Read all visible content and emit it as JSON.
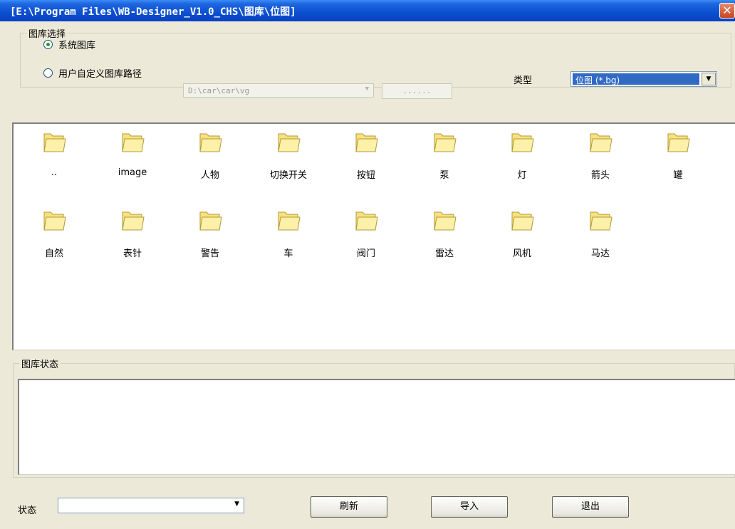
{
  "window": {
    "title": "[E:\\Program Files\\WB-Designer_V1.0_CHS\\图库\\位图]",
    "close_glyph": "✕"
  },
  "library_select": {
    "legend": "图库选择",
    "system_label": "系统图库",
    "custom_label": "用户自定义图库路径",
    "custom_path": "D:\\car\\car\\vg",
    "browse_label": "......",
    "type_label": "类型",
    "type_value": "位图 (*.bg)",
    "selected": "system"
  },
  "files": [
    {
      "label": ".."
    },
    {
      "label": "image"
    },
    {
      "label": "人物"
    },
    {
      "label": "切换开关"
    },
    {
      "label": "按钮"
    },
    {
      "label": "泵"
    },
    {
      "label": "灯"
    },
    {
      "label": "箭头"
    },
    {
      "label": "罐"
    },
    {
      "label": "自然"
    },
    {
      "label": "表针"
    },
    {
      "label": "警告"
    },
    {
      "label": "车"
    },
    {
      "label": "阀门"
    },
    {
      "label": "雷达"
    },
    {
      "label": "风机"
    },
    {
      "label": "马达"
    }
  ],
  "status_group": {
    "legend": "图库状态",
    "text": ""
  },
  "bottom": {
    "state_label": "状态",
    "state_value": "",
    "refresh_label": "刷新",
    "import_label": "导入",
    "exit_label": "退出"
  },
  "icons": {
    "folder": "folder-icon",
    "dropdown": "chevron-down-icon"
  },
  "colors": {
    "titlebar": "#0a4fd0",
    "selection": "#316ac5",
    "folder_fill": "#f9e27d"
  }
}
